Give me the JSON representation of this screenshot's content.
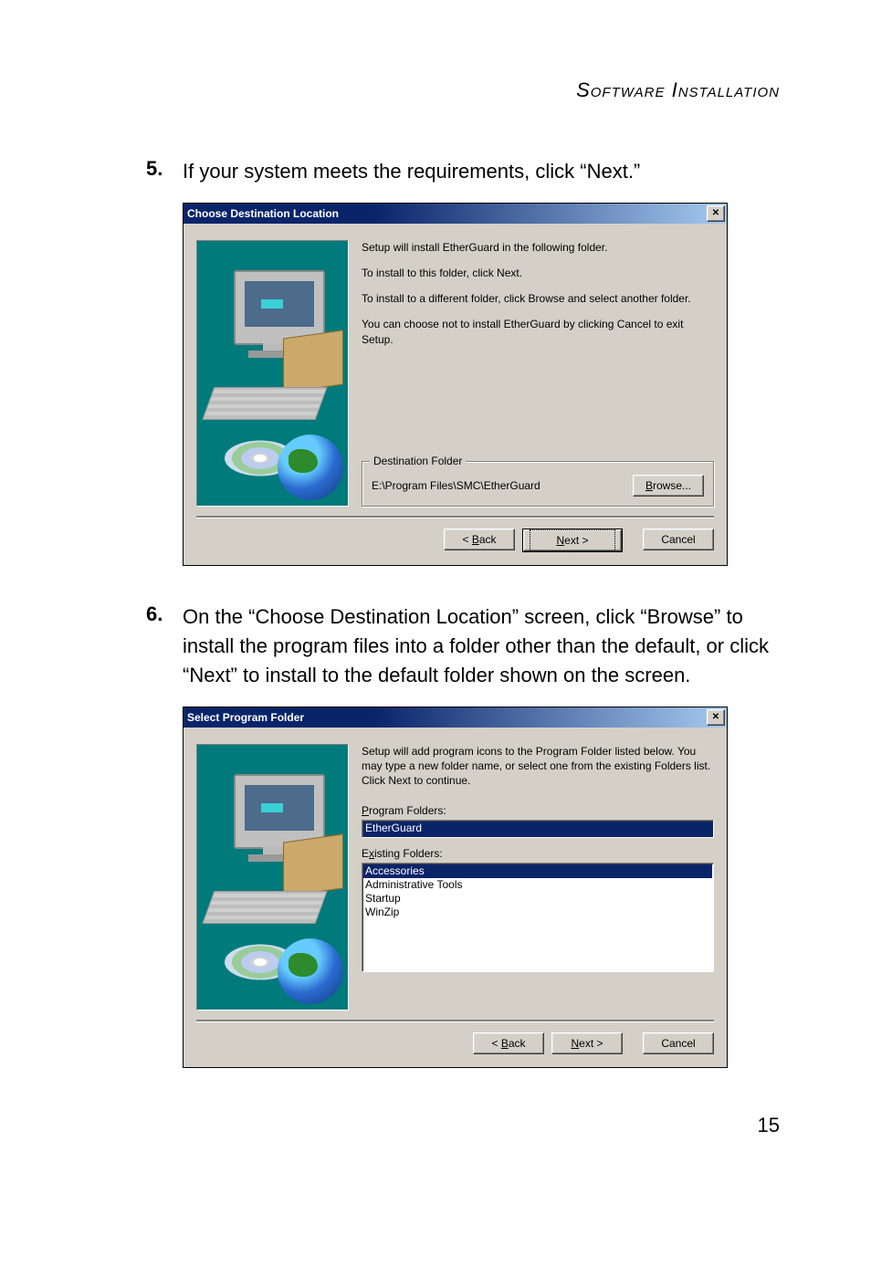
{
  "header": "Software Installation",
  "page_number": "15",
  "step5": {
    "num": "5.",
    "text": "If your system meets the requirements, click “Next.”"
  },
  "step6": {
    "num": "6.",
    "text": "On the “Choose Destination Location” screen, click “Browse” to install the program files into a folder other than the default, or click “Next” to install to the default folder shown on the screen."
  },
  "dialog1": {
    "title": "Choose Destination Location",
    "p1": "Setup will install EtherGuard in the following folder.",
    "p2": "To install to this folder, click Next.",
    "p3": "To install to a different folder, click Browse and select another folder.",
    "p4": "You can choose not to install EtherGuard by clicking Cancel to exit Setup.",
    "group_label": "Destination Folder",
    "path": "E:\\Program Files\\SMC\\EtherGuard",
    "browse_prefix": "B",
    "browse_rest": "rowse...",
    "back_prefix": "< ",
    "back_ul": "B",
    "back_rest": "ack",
    "next_ul": "N",
    "next_rest": "ext >",
    "cancel": "Cancel"
  },
  "dialog2": {
    "title": "Select Program Folder",
    "p1": "Setup will add program icons to the Program Folder listed below.  You may type a new folder name, or select one from the existing Folders list.  Click Next to continue.",
    "pf_ul": "P",
    "pf_rest": "rogram Folders:",
    "pf_value": "EtherGuard",
    "ef_prefix": "E",
    "ef_ul": "x",
    "ef_rest": "isting Folders:",
    "items": [
      "Accessories",
      "Administrative Tools",
      "Startup",
      "WinZip"
    ],
    "back_prefix": "< ",
    "back_ul": "B",
    "back_rest": "ack",
    "next_ul": "N",
    "next_rest": "ext >",
    "cancel": "Cancel"
  }
}
